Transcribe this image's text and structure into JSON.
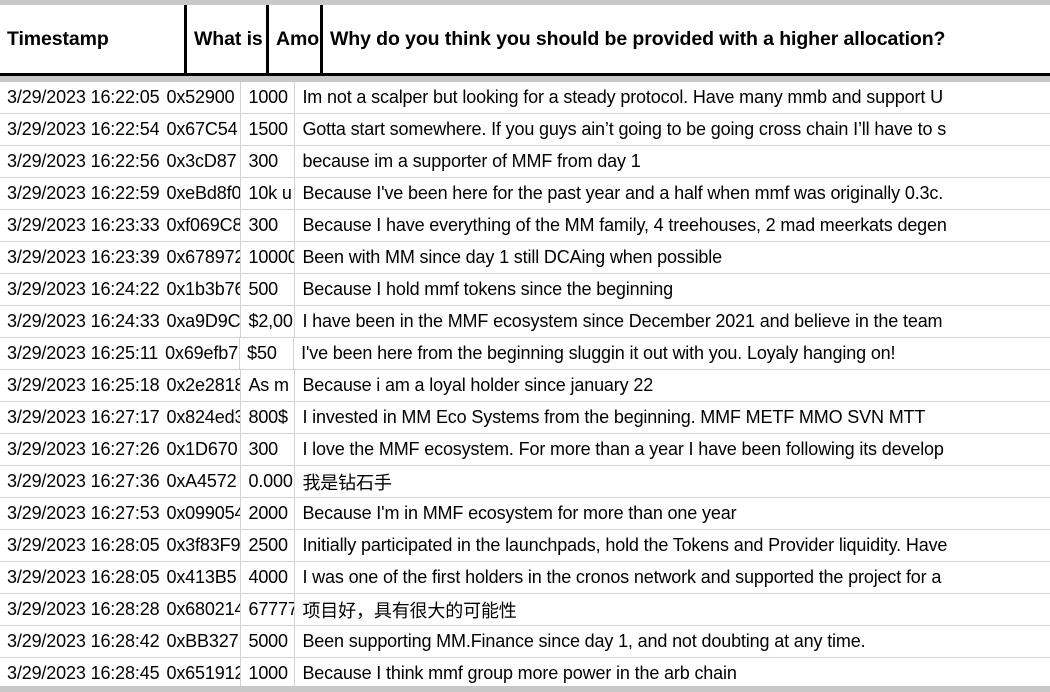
{
  "app": {
    "type": "spreadsheet-table",
    "colors": {
      "grid_line": "#d3d3d3",
      "header_rule": "#000000",
      "strip": "#c8c8c8",
      "background": "#ffffff",
      "text": "#000000"
    }
  },
  "table": {
    "columns": [
      {
        "key": "timestamp",
        "label": "Timestamp",
        "clipped": false
      },
      {
        "key": "wallet",
        "label": "What is ",
        "clipped": true
      },
      {
        "key": "amount",
        "label": "Amo",
        "clipped": true
      },
      {
        "key": "why",
        "label": "Why do you think you should be provided with a higher allocation?",
        "clipped": false
      }
    ],
    "rows": [
      {
        "timestamp": "3/29/2023 16:22:05",
        "wallet": "0x52900",
        "amount": "1000",
        "why": "Im not a scalper but looking for a steady protocol. Have many mmb and support U"
      },
      {
        "timestamp": "3/29/2023 16:22:54",
        "wallet": "0x67C54",
        "amount": "1500",
        "why": "Gotta start somewhere. If you guys ain’t going to be going cross chain I’ll have to s"
      },
      {
        "timestamp": "3/29/2023 16:22:56",
        "wallet": "0x3cD87",
        "amount": "300",
        "why": "because im a supporter of MMF from day 1"
      },
      {
        "timestamp": "3/29/2023 16:22:59",
        "wallet": "0xeBd8f0",
        "amount": "10k u",
        "why": "Because I've been here for the past year and a half when mmf was originally 0.3c."
      },
      {
        "timestamp": "3/29/2023 16:23:33",
        "wallet": "0xf069C8",
        "amount": "300",
        "why": "Because I have everything of the MM family, 4 treehouses, 2 mad meerkats degen"
      },
      {
        "timestamp": "3/29/2023 16:23:39",
        "wallet": "0x678972",
        "amount": "10000",
        "why": "Been with MM since day 1 still DCAing when possible"
      },
      {
        "timestamp": "3/29/2023 16:24:22",
        "wallet": "0x1b3b76",
        "amount": "500",
        "why": "Because I hold mmf tokens since the beginning"
      },
      {
        "timestamp": "3/29/2023 16:24:33",
        "wallet": "0xa9D9C",
        "amount": "$2,00",
        "why": "I have been in the MMF ecosystem since December 2021 and believe in the team"
      },
      {
        "timestamp": "3/29/2023 16:25:11",
        "wallet": "0x69efb7",
        "amount": "$50",
        "why": "I've been here from the beginning sluggin it out with you. Loyaly hanging on!"
      },
      {
        "timestamp": "3/29/2023 16:25:18",
        "wallet": "0x2e2818",
        "amount": "As m",
        "why": "Because i am a loyal holder since january 22"
      },
      {
        "timestamp": "3/29/2023 16:27:17",
        "wallet": "0x824ed3",
        "amount": "800$",
        "why": "I invested in MM Eco Systems from the beginning.  MMF METF MMO  SVN MTT "
      },
      {
        "timestamp": "3/29/2023 16:27:26",
        "wallet": "0x1D670",
        "amount": "300",
        "why": "I love the MMF ecosystem. For more than a year I have been following its develop"
      },
      {
        "timestamp": "3/29/2023 16:27:36",
        "wallet": "0xA4572",
        "amount": "0.000",
        "why": "我是钻石手"
      },
      {
        "timestamp": "3/29/2023 16:27:53",
        "wallet": "0x099054",
        "amount": "2000",
        "why": "Because I'm in MMF ecosystem for more than one year"
      },
      {
        "timestamp": "3/29/2023 16:28:05",
        "wallet": "0x3f83F9",
        "amount": "2500",
        "why": "Initially participated in the launchpads, hold the Tokens and Provider liquidity. Have"
      },
      {
        "timestamp": "3/29/2023 16:28:05",
        "wallet": "0x413B5",
        "amount": "4000",
        "why": "I was one of the first holders in the cronos network and supported the project for a"
      },
      {
        "timestamp": "3/29/2023 16:28:28",
        "wallet": "0x680214",
        "amount": "67777",
        "why": "项目好，具有很大的可能性"
      },
      {
        "timestamp": "3/29/2023 16:28:42",
        "wallet": "0xBB327",
        "amount": "5000",
        "why": "Been supporting MM.Finance since day 1, and not doubting at any time."
      },
      {
        "timestamp": "3/29/2023 16:28:45",
        "wallet": "0x651912",
        "amount": "1000",
        "why": "Because I think mmf group more power in the arb chain"
      }
    ]
  }
}
